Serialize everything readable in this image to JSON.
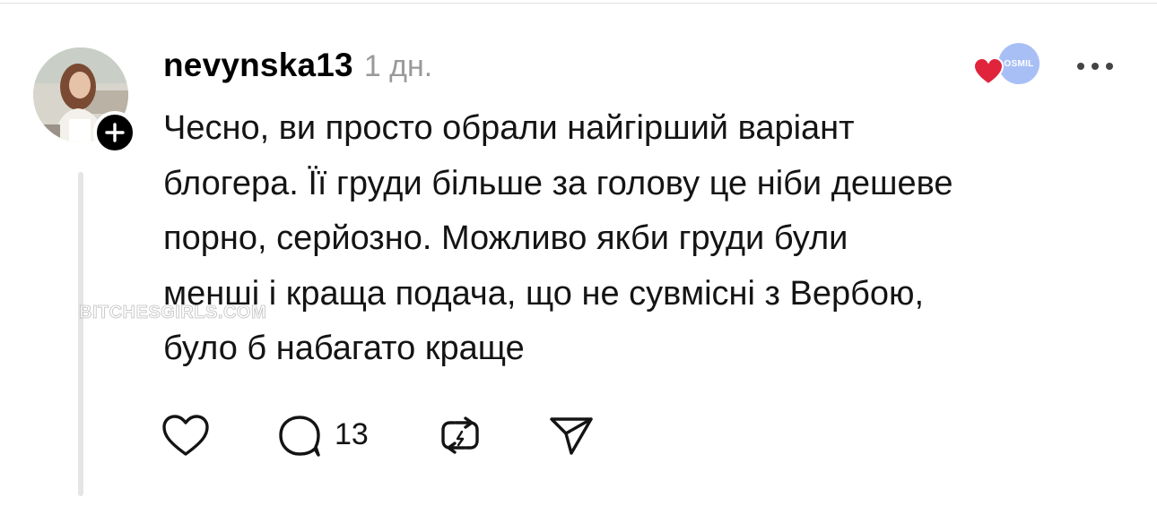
{
  "post": {
    "author": {
      "username": "nevynska13",
      "avatar_icon": "profile-photo",
      "follow_icon": "plus-icon"
    },
    "time_ago": "1 дн.",
    "reactions": {
      "badge_text": "OSMIL",
      "heart_icon": "heart-icon",
      "heart_color": "#e0243c",
      "badge_color": "#a8bff6"
    },
    "more_icon": "more-dots-icon",
    "text_lines": [
      "Чесно, ви просто обрали найгірший варіант",
      "блогера. Її груди більше за голову це ніби дешеве",
      "порно, серйозно. Можливо якби груди були",
      "менші і краща подача, що не сувмісні з Вербою,",
      "було б набагато краще"
    ],
    "actions": {
      "like_icon": "heart-outline-icon",
      "reply_icon": "comment-icon",
      "reply_count": "13",
      "repost_icon": "repost-icon",
      "share_icon": "send-icon"
    }
  },
  "watermark": "BITCHESGIRLS.COM"
}
